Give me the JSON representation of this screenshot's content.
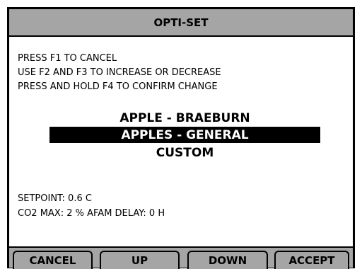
{
  "title": "OPTI-SET",
  "instructions": [
    "PRESS F1 TO CANCEL",
    "USE F2 AND F3 TO INCREASE OR DECREASE",
    "PRESS AND HOLD F4 TO CONFIRM CHANGE"
  ],
  "options": [
    {
      "label": "APPLE - BRAEBURN",
      "selected": false
    },
    {
      "label": "APPLES - GENERAL",
      "selected": true
    },
    {
      "label": "CUSTOM",
      "selected": false
    }
  ],
  "info": {
    "setpoint": "SETPOINT: 0.6 C",
    "co2_line": "CO2 MAX: 2 % AFAM DELAY: 0 H"
  },
  "softkeys": {
    "f1": "CANCEL",
    "f2": "UP",
    "f3": "DOWN",
    "f4": "ACCEPT"
  },
  "colors": {
    "titlebar": "#a5a5a5",
    "selection": "#000000",
    "background": "#ffffff"
  }
}
